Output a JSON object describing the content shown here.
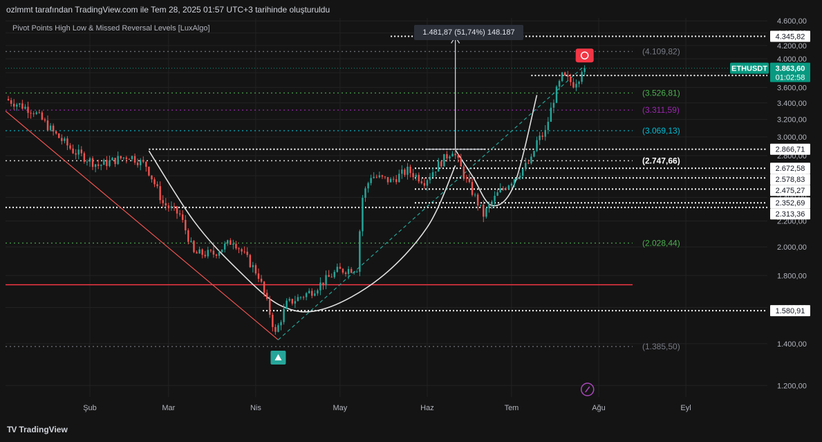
{
  "header": {
    "author_line": "ozlmmt tarafından TradingView.com ile Tem 28, 2025 01:57 UTC+3 tarihinde oluşturuldu"
  },
  "indicator": {
    "title": "Pivot Points High Low & Missed Reversal Levels [LuxAlgo]"
  },
  "measure": {
    "label": "1.481,87 (51,74%) 148.187"
  },
  "footer": {
    "brand": "TradingView",
    "logo_mark": "TV"
  },
  "chart_data": {
    "type": "candlestick",
    "symbol": "ETHUSDT",
    "last_price": 3863.6,
    "last_price_label": "3.863,60",
    "countdown": "01:02:58",
    "x_ticks": [
      "Şub",
      "Mar",
      "Nis",
      "May",
      "Haz",
      "Tem",
      "Ağu",
      "Eyl"
    ],
    "x_range": [
      "2025-01-02",
      "2025-09-30"
    ],
    "y_axis": {
      "scale": "log",
      "ticks": [
        "1.200,00",
        "1.400,00",
        "1.600,00",
        "1.800,00",
        "2.000,00",
        "2.200,00",
        "2.400,00",
        "2.600,00",
        "2.800,00",
        "3.000,00",
        "3.200,00",
        "3.400,00",
        "3.600,00",
        "3.800,00",
        "4.000,00",
        "4.200,00",
        "4.400,00",
        "4.600,00"
      ],
      "tick_values": [
        1200,
        1400,
        1600,
        1800,
        2000,
        2200,
        2400,
        2600,
        2800,
        3000,
        3200,
        3400,
        3600,
        3800,
        4000,
        4200,
        4400,
        4600
      ],
      "range": [
        1150,
        4650
      ]
    },
    "price_path": [
      {
        "date": "2025-01-03",
        "price": 3450
      },
      {
        "date": "2025-01-13",
        "price": 3300
      },
      {
        "date": "2025-01-20",
        "price": 3050
      },
      {
        "date": "2025-01-27",
        "price": 2850
      },
      {
        "date": "2025-02-05",
        "price": 2700
      },
      {
        "date": "2025-02-16",
        "price": 2800
      },
      {
        "date": "2025-02-22",
        "price": 2700
      },
      {
        "date": "2025-02-28",
        "price": 2350
      },
      {
        "date": "2025-03-06",
        "price": 2250
      },
      {
        "date": "2025-03-11",
        "price": 1950
      },
      {
        "date": "2025-03-18",
        "price": 1950
      },
      {
        "date": "2025-03-25",
        "price": 2050
      },
      {
        "date": "2025-04-03",
        "price": 1800
      },
      {
        "date": "2025-04-09",
        "price": 1450
      },
      {
        "date": "2025-04-13",
        "price": 1620
      },
      {
        "date": "2025-04-22",
        "price": 1700
      },
      {
        "date": "2025-05-01",
        "price": 1830
      },
      {
        "date": "2025-05-08",
        "price": 1850
      },
      {
        "date": "2025-05-10",
        "price": 2400
      },
      {
        "date": "2025-05-13",
        "price": 2600
      },
      {
        "date": "2025-05-20",
        "price": 2550
      },
      {
        "date": "2025-05-26",
        "price": 2650
      },
      {
        "date": "2025-06-01",
        "price": 2550
      },
      {
        "date": "2025-06-11",
        "price": 2860
      },
      {
        "date": "2025-06-16",
        "price": 2550
      },
      {
        "date": "2025-06-22",
        "price": 2250
      },
      {
        "date": "2025-06-27",
        "price": 2430
      },
      {
        "date": "2025-07-03",
        "price": 2580
      },
      {
        "date": "2025-07-09",
        "price": 2750
      },
      {
        "date": "2025-07-11",
        "price": 2950
      },
      {
        "date": "2025-07-14",
        "price": 3050
      },
      {
        "date": "2025-07-17",
        "price": 3450
      },
      {
        "date": "2025-07-20",
        "price": 3750
      },
      {
        "date": "2025-07-24",
        "price": 3650
      },
      {
        "date": "2025-07-26",
        "price": 3740
      },
      {
        "date": "2025-07-27",
        "price": 3863.6
      }
    ],
    "dashed_levels": [
      {
        "label": "(4.109,82)",
        "value": 4109.82,
        "color": "#787b86"
      },
      {
        "label": "(3.526,81)",
        "value": 3526.81,
        "color": "#4caf50"
      },
      {
        "label": "(3.311,59)",
        "value": 3311.59,
        "color": "#9c27b0"
      },
      {
        "label": "(3.069,13)",
        "value": 3069.13,
        "color": "#00bcd4"
      },
      {
        "label": "(2.747,66)",
        "value": 2747.66,
        "color": "#ffffff"
      },
      {
        "label": "(2.028,44)",
        "value": 2028.44,
        "color": "#4caf50"
      },
      {
        "label": "(1.385,50)",
        "value": 1385.5,
        "color": "#787b86"
      }
    ],
    "dotted_levels": [
      {
        "label": "4.345,82",
        "value": 4345.82
      },
      {
        "label": "3.761,98",
        "value": 3761.98
      },
      {
        "label": "2.866,71",
        "value": 2866.71
      },
      {
        "label": "2.672,58",
        "value": 2672.58
      },
      {
        "label": "2.578,83",
        "value": 2578.83
      },
      {
        "label": "2.475,27",
        "value": 2475.27
      },
      {
        "label": "2.352,69",
        "value": 2352.69
      },
      {
        "label": "2.313,36",
        "value": 2313.36
      },
      {
        "label": "1.580,91",
        "value": 1580.91
      }
    ],
    "support_line": {
      "value": 1740,
      "color": "#f23645"
    },
    "trendline_down": {
      "from": {
        "date": "2025-01-02",
        "price": 3300
      },
      "to": {
        "date": "2025-04-09",
        "price": 1420
      }
    },
    "trendline_up_dashed": {
      "from": {
        "date": "2025-04-09",
        "price": 1420
      },
      "to": {
        "date": "2025-07-27",
        "price": 3900
      }
    },
    "measure_arrow": {
      "date": "2025-06-11",
      "from": 2866.71,
      "to": 4345.82
    },
    "colors": {
      "up": "#26a69a",
      "down": "#ef5350",
      "background": "#141414",
      "grid": "#222222",
      "price_tag": "#089981"
    }
  }
}
